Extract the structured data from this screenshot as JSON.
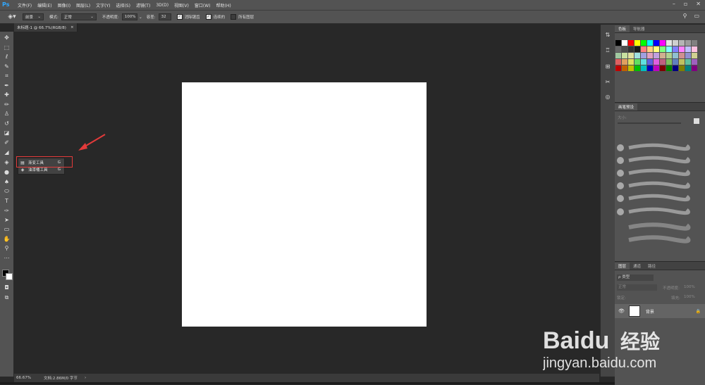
{
  "app": {
    "logo": "Ps"
  },
  "menu": [
    "文件(F)",
    "编辑(E)",
    "图像(I)",
    "图层(L)",
    "文字(Y)",
    "选择(S)",
    "滤镜(T)",
    "3D(D)",
    "视图(V)",
    "窗口(W)",
    "帮助(H)"
  ],
  "options": {
    "fill_source": "前景",
    "mode_label": "模式:",
    "mode_value": "正常",
    "opacity_label": "不透明度:",
    "opacity_value": "100%",
    "tolerance_label": "容差:",
    "tolerance_value": "32",
    "anti_alias": "消除锯齿",
    "contiguous": "连续的",
    "all_layers": "所有图层"
  },
  "document_tab": {
    "title": "未标题-1 @ 66.7%(RGB/8)",
    "close": "×"
  },
  "flyout": {
    "items": [
      {
        "label": "渐变工具",
        "key": "G"
      },
      {
        "label": "油漆桶工具",
        "key": "G"
      }
    ]
  },
  "status": {
    "zoom": "66.67%",
    "doc_info": "文档:2.86M/0 字节"
  },
  "panels": {
    "swatches_tabs": [
      "色板",
      "导航器"
    ],
    "brush_tab": "画笔预设",
    "brush_size_label": "大小:",
    "layers_tabs": [
      "图层",
      "通道",
      "路径"
    ],
    "layer_kind": "ρ 类型",
    "layer_mode": "正常",
    "layer_opacity_label": "不透明度:",
    "layer_opacity_value": "100%",
    "lock_label": "锁定:",
    "fill_label": "填充:",
    "fill_value": "100%",
    "layer_name": "背景"
  },
  "watermark": {
    "brand": "Baidu",
    "brand_cn": "经验",
    "url": "jingyan.baidu.com"
  },
  "colors": {
    "canvas": "#ffffff",
    "highlight_box": "#e23a3a",
    "arrow": "#e23a3a"
  }
}
